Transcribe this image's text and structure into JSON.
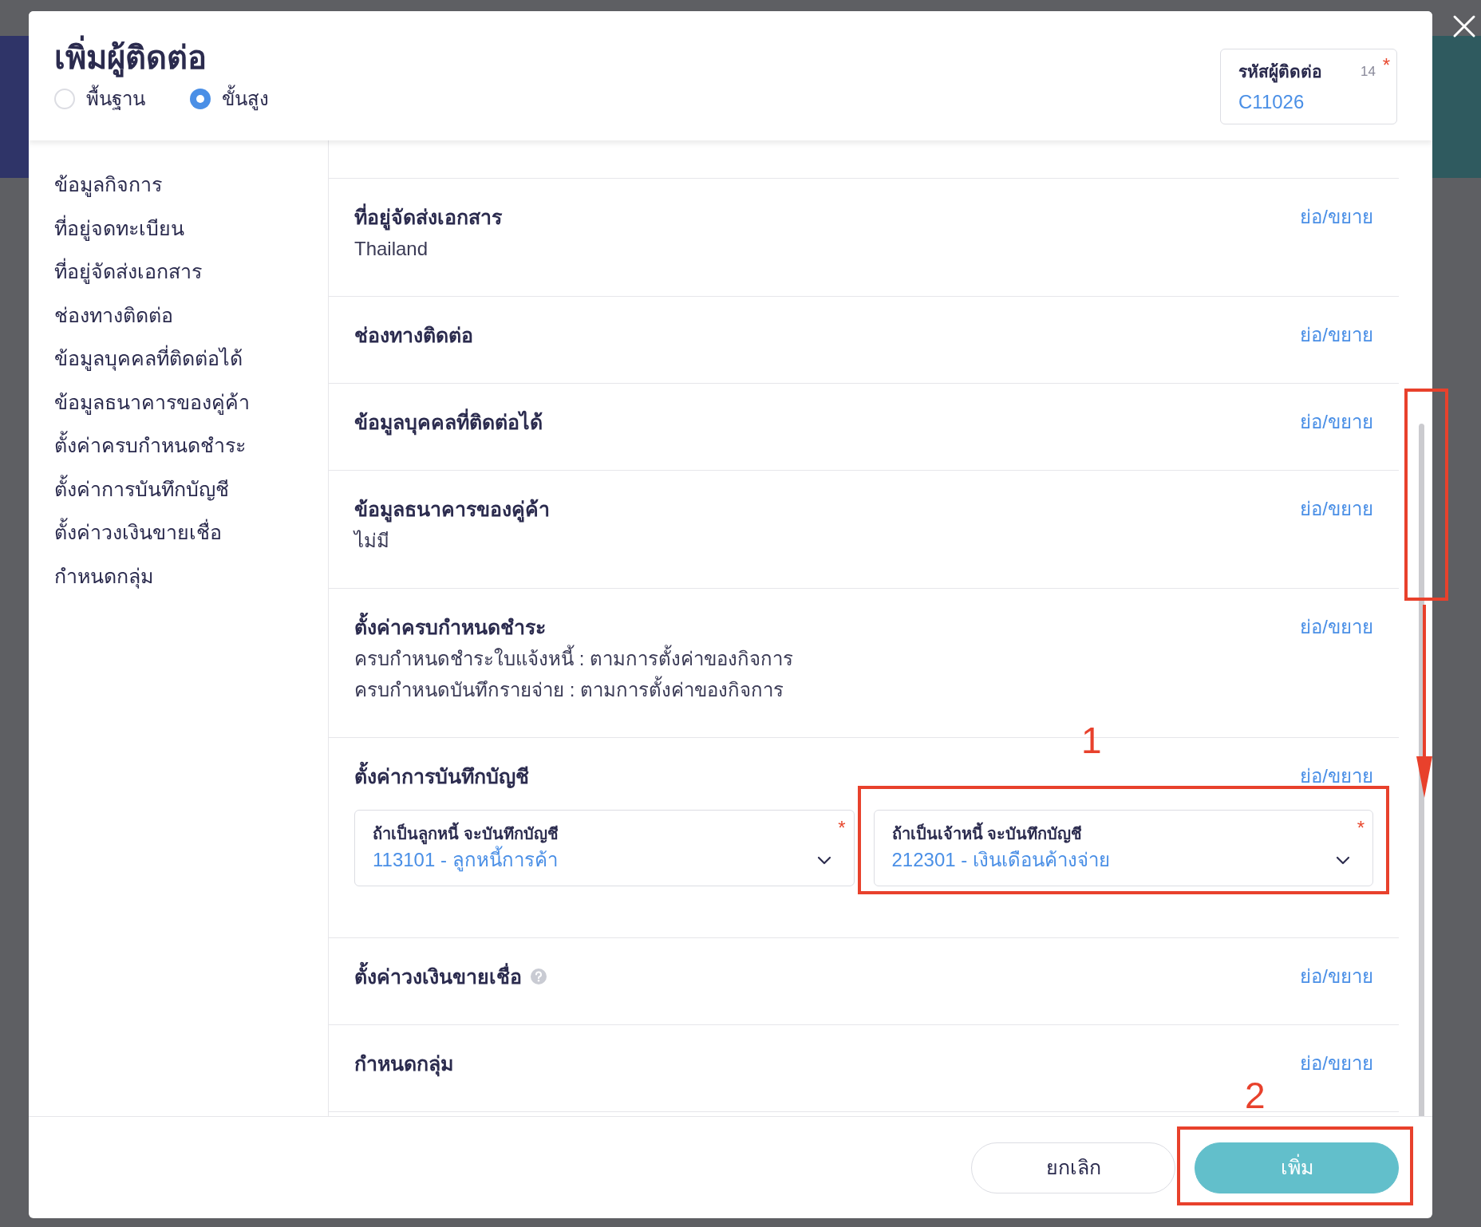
{
  "dialog": {
    "title": "เพิ่มผู้ติดต่อ",
    "modes": [
      {
        "label": "พื้นฐาน",
        "selected": false
      },
      {
        "label": "ขั้นสูง",
        "selected": true
      }
    ],
    "contact_code": {
      "label": "รหัสผู้ติดต่อ",
      "counter": "14",
      "required_mark": "*",
      "value": "C11026"
    }
  },
  "sidebar": {
    "items": [
      "ข้อมูลกิจการ",
      "ที่อยู่จดทะเบียน",
      "ที่อยู่จัดส่งเอกสาร",
      "ช่องทางติดต่อ",
      "ข้อมูลบุคคลที่ติดต่อได้",
      "ข้อมูลธนาคารของคู่ค้า",
      "ตั้งค่าครบกำหนดชำระ",
      "ตั้งค่าการบันทึกบัญชี",
      "ตั้งค่าวงเงินขายเชื่อ",
      "กำหนดกลุ่ม"
    ]
  },
  "sections": [
    {
      "kind": "text",
      "title": "ที่อยู่จัดส่งเอกสาร",
      "toggle": "ย่อ/ขยาย",
      "lines": [
        "Thailand"
      ]
    },
    {
      "kind": "text",
      "title": "ช่องทางติดต่อ",
      "toggle": "ย่อ/ขยาย"
    },
    {
      "kind": "text",
      "title": "ข้อมูลบุคคลที่ติดต่อได้",
      "toggle": "ย่อ/ขยาย"
    },
    {
      "kind": "text",
      "title": "ข้อมูลธนาคารของคู่ค้า",
      "toggle": "ย่อ/ขยาย",
      "lines": [
        "ไม่มี"
      ]
    },
    {
      "kind": "text",
      "title": "ตั้งค่าครบกำหนดชำระ",
      "toggle": "ย่อ/ขยาย",
      "lines": [
        "ครบกำหนดชำระใบแจ้งหนี้ : ตามการตั้งค่าของกิจการ",
        "ครบกำหนดบันทึกรายจ่าย : ตามการตั้งค่าของกิจการ"
      ]
    },
    {
      "kind": "accounts",
      "title": "ตั้งค่าการบันทึกบัญชี",
      "toggle": "ย่อ/ขยาย",
      "fields": [
        {
          "label": "ถ้าเป็นลูกหนี้ จะบันทึกบัญชี",
          "value": "113101 - ลูกหนี้การค้า",
          "required_mark": "*"
        },
        {
          "label": "ถ้าเป็นเจ้าหนี้ จะบันทึกบัญชี",
          "value": "212301 - เงินเดือนค้างจ่าย",
          "required_mark": "*"
        }
      ]
    },
    {
      "kind": "help",
      "title": "ตั้งค่าวงเงินขายเชื่อ",
      "toggle": "ย่อ/ขยาย"
    },
    {
      "kind": "text",
      "title": "กำหนดกลุ่ม",
      "toggle": "ย่อ/ขยาย"
    }
  ],
  "footer": {
    "buttons": [
      {
        "label": "ยกเลิก",
        "kind": "secondary"
      },
      {
        "label": "เพิ่ม",
        "kind": "primary"
      }
    ]
  },
  "annotations": [
    {
      "label": "1"
    },
    {
      "label": "2"
    }
  ]
}
